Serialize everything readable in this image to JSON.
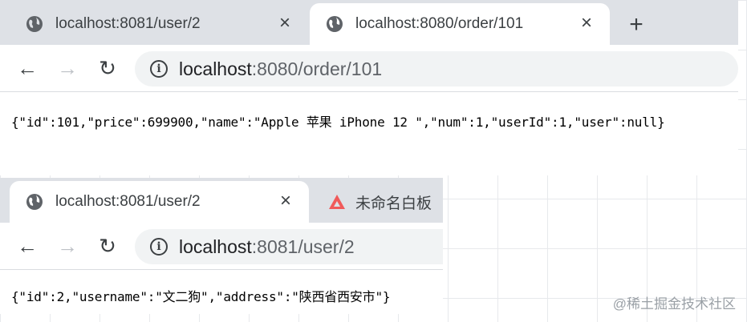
{
  "window1": {
    "tabs": [
      {
        "label": "localhost:8081/user/2",
        "icon": "globe-icon",
        "active": false
      },
      {
        "label": "localhost:8080/order/101",
        "icon": "globe-icon",
        "active": true
      }
    ],
    "new_tab_label": "+",
    "address": {
      "host": "localhost",
      "rest": ":8080/order/101"
    },
    "body_text": "{\"id\":101,\"price\":699900,\"name\":\"Apple 苹果 iPhone 12 \",\"num\":1,\"userId\":1,\"user\":null}"
  },
  "window2": {
    "tabs": [
      {
        "label": "localhost:8081/user/2",
        "icon": "globe-icon",
        "active": true
      },
      {
        "label": "未命名白板",
        "icon": "triangle-logo-icon",
        "active": false
      }
    ],
    "address": {
      "host": "localhost",
      "rest": ":8081/user/2"
    },
    "body_text": "{\"id\":2,\"username\":\"文二狗\",\"address\":\"陕西省西安市\"}"
  },
  "watermark": "@稀土掘金技术社区",
  "colors": {
    "tabstrip": "#dee1e6",
    "omnibox": "#f1f3f4",
    "text": "#3c4043",
    "disabled": "#bdc1c6",
    "logo_red": "#f05a5a"
  }
}
